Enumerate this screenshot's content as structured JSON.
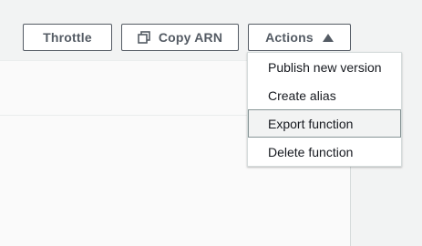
{
  "toolbar": {
    "throttle_label": "Throttle",
    "copy_arn_label": "Copy ARN",
    "actions_label": "Actions"
  },
  "icons": {
    "copy": "copy-icon",
    "caret": "caret-up-icon"
  },
  "actions_menu": {
    "items": [
      {
        "label": "Publish new version",
        "highlighted": false
      },
      {
        "label": "Create alias",
        "highlighted": false
      },
      {
        "label": "Export function",
        "highlighted": true
      },
      {
        "label": "Delete function",
        "highlighted": false
      }
    ]
  },
  "colors": {
    "button_border": "#545b64",
    "button_text": "#545b64",
    "highlight_bg": "#f2f3f3",
    "highlight_border": "#879596"
  }
}
